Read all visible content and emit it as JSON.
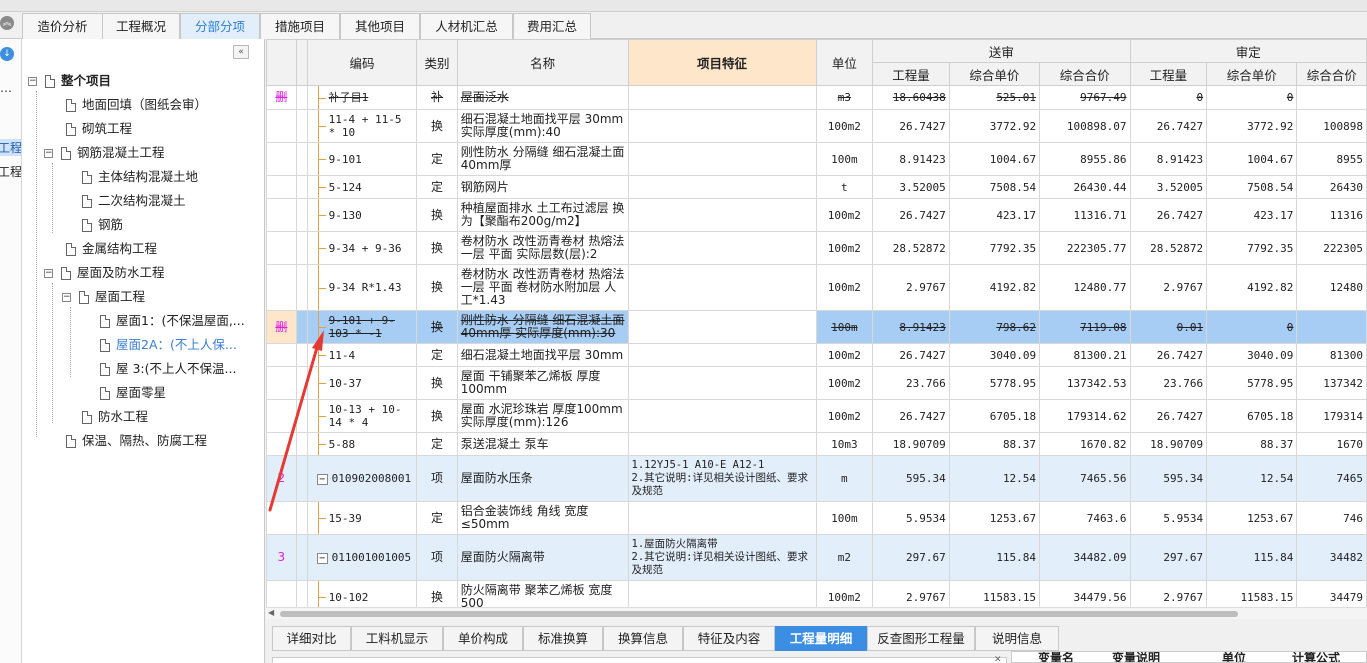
{
  "tabs": [
    "造价分析",
    "工程概况",
    "分部分项",
    "措施项目",
    "其他项目",
    "人材机汇总",
    "费用汇总"
  ],
  "active_tab_index": 2,
  "rail": {
    "dots": "…",
    "item1": "工程",
    "item2": "工程"
  },
  "tree": {
    "collapse_icon": "«",
    "items": [
      {
        "label": "整个项目",
        "bold": true
      },
      {
        "label": "地面回填（图纸会审）"
      },
      {
        "label": "砌筑工程"
      },
      {
        "label": "钢筋混凝土工程"
      },
      {
        "label": "主体结构混凝土地"
      },
      {
        "label": "二次结构混凝土"
      },
      {
        "label": "钢筋"
      },
      {
        "label": "金属结构工程"
      },
      {
        "label": "屋面及防水工程"
      },
      {
        "label": "屋面工程"
      },
      {
        "label": "屋面1：(不保温屋面,..."
      },
      {
        "label": "屋面2A：(不上人保..."
      },
      {
        "label": "屋 3:(不上人不保温..."
      },
      {
        "label": "屋面零星"
      },
      {
        "label": "防水工程"
      },
      {
        "label": "保温、隔热、防腐工程"
      }
    ]
  },
  "grid": {
    "headers": {
      "code": "编码",
      "type": "类别",
      "name": "名称",
      "feature": "项目特征",
      "unit": "单位",
      "group_submit": "送审",
      "group_review": "审定",
      "qty": "工程量",
      "unit_price": "综合单价",
      "total": "综合合价"
    },
    "rows": [
      {
        "mark": "删",
        "code": "补子目1",
        "type": "补",
        "name": "屋面泛水",
        "feature": "",
        "unit": "m3",
        "s_qty": "18.60438",
        "s_up": "525.01",
        "s_tot": "9767.49",
        "r_qty": "0",
        "r_up": "0",
        "r_tot": "",
        "kind": "del"
      },
      {
        "mark": "",
        "code": "11-4 + 11-5 * 10",
        "type": "换",
        "name": "细石混凝土地面找平层 30mm 实际厚度(mm):40",
        "feature": "",
        "unit": "100m2",
        "s_qty": "26.7427",
        "s_up": "3772.92",
        "s_tot": "100898.07",
        "r_qty": "26.7427",
        "r_up": "3772.92",
        "r_tot": "100898",
        "kind": "sub"
      },
      {
        "mark": "",
        "code": "9-101",
        "type": "定",
        "name": "刚性防水 分隔缝 细石混凝土面 40mm厚",
        "feature": "",
        "unit": "100m",
        "s_qty": "8.91423",
        "s_up": "1004.67",
        "s_tot": "8955.86",
        "r_qty": "8.91423",
        "r_up": "1004.67",
        "r_tot": "8955",
        "kind": "sub"
      },
      {
        "mark": "",
        "code": "5-124",
        "type": "定",
        "name": "钢筋网片",
        "feature": "",
        "unit": "t",
        "s_qty": "3.52005",
        "s_up": "7508.54",
        "s_tot": "26430.44",
        "r_qty": "3.52005",
        "r_up": "7508.54",
        "r_tot": "26430",
        "kind": "sub"
      },
      {
        "mark": "",
        "code": "9-130",
        "type": "换",
        "name": "种植屋面排水 土工布过滤层 换为【聚酯布200g/m2】",
        "feature": "",
        "unit": "100m2",
        "s_qty": "26.7427",
        "s_up": "423.17",
        "s_tot": "11316.71",
        "r_qty": "26.7427",
        "r_up": "423.17",
        "r_tot": "11316",
        "kind": "sub"
      },
      {
        "mark": "",
        "code": "9-34 + 9-36",
        "type": "换",
        "name": "卷材防水 改性沥青卷材 热熔法一层 平面  实际层数(层):2",
        "feature": "",
        "unit": "100m2",
        "s_qty": "28.52872",
        "s_up": "7792.35",
        "s_tot": "222305.77",
        "r_qty": "28.52872",
        "r_up": "7792.35",
        "r_tot": "222305",
        "kind": "sub"
      },
      {
        "mark": "",
        "code": "9-34 R*1.43",
        "type": "换",
        "name": "卷材防水 改性沥青卷材 热熔法一层 平面  卷材防水附加层 人工*1.43",
        "feature": "",
        "unit": "100m2",
        "s_qty": "2.9767",
        "s_up": "4192.82",
        "s_tot": "12480.77",
        "r_qty": "2.9767",
        "r_up": "4192.82",
        "r_tot": "12480",
        "kind": "sub"
      },
      {
        "mark": "删",
        "code": "9-101 + 9-103 * -1",
        "type": "换",
        "name": "刚性防水 分隔缝 细石混凝土面 40mm厚  实际厚度(mm):30",
        "feature": "",
        "unit": "100m",
        "s_qty": "8.91423",
        "s_up": "798.62",
        "s_tot": "7119.08",
        "r_qty": "0.01",
        "r_up": "0",
        "r_tot": "",
        "kind": "sel"
      },
      {
        "mark": "",
        "code": "11-4",
        "type": "定",
        "name": "细石混凝土地面找平层 30mm",
        "feature": "",
        "unit": "100m2",
        "s_qty": "26.7427",
        "s_up": "3040.09",
        "s_tot": "81300.21",
        "r_qty": "26.7427",
        "r_up": "3040.09",
        "r_tot": "81300",
        "kind": "sub"
      },
      {
        "mark": "",
        "code": "10-37",
        "type": "换",
        "name": "屋面 干铺聚苯乙烯板 厚度 100mm",
        "feature": "",
        "unit": "100m2",
        "s_qty": "23.766",
        "s_up": "5778.95",
        "s_tot": "137342.53",
        "r_qty": "23.766",
        "r_up": "5778.95",
        "r_tot": "137342",
        "kind": "sub"
      },
      {
        "mark": "",
        "code": "10-13 + 10-14 * 4",
        "type": "换",
        "name": "屋面 水泥珍珠岩 厚度100mm 实际厚度(mm):126",
        "feature": "",
        "unit": "100m2",
        "s_qty": "26.7427",
        "s_up": "6705.18",
        "s_tot": "179314.62",
        "r_qty": "26.7427",
        "r_up": "6705.18",
        "r_tot": "179314",
        "kind": "sub"
      },
      {
        "mark": "",
        "code": "5-88",
        "type": "定",
        "name": "泵送混凝土 泵车",
        "feature": "",
        "unit": "10m3",
        "s_qty": "18.90709",
        "s_up": "88.37",
        "s_tot": "1670.82",
        "r_qty": "18.90709",
        "r_up": "88.37",
        "r_tot": "1670",
        "kind": "sub"
      },
      {
        "mark": "2",
        "code": "010902008001",
        "type": "项",
        "name": "屋面防水压条",
        "feature": "1.12YJ5-1 A10-E A12-1\n2.其它说明:详见相关设计图纸、要求及规范",
        "unit": "m",
        "s_qty": "595.34",
        "s_up": "12.54",
        "s_tot": "7465.56",
        "r_qty": "595.34",
        "r_up": "12.54",
        "r_tot": "7465",
        "kind": "xiang"
      },
      {
        "mark": "",
        "code": "15-39",
        "type": "定",
        "name": "铝合金装饰线 角线 宽度≤50mm",
        "feature": "",
        "unit": "100m",
        "s_qty": "5.9534",
        "s_up": "1253.67",
        "s_tot": "7463.6",
        "r_qty": "5.9534",
        "r_up": "1253.67",
        "r_tot": "746",
        "kind": "sub"
      },
      {
        "mark": "3",
        "code": "011001001005",
        "type": "项",
        "name": "屋面防火隔离带",
        "feature": "1.屋面防火隔离带\n2.其它说明:详见相关设计图纸、要求及规范",
        "unit": "m2",
        "s_qty": "297.67",
        "s_up": "115.84",
        "s_tot": "34482.09",
        "r_qty": "297.67",
        "r_up": "115.84",
        "r_tot": "34482",
        "kind": "xiang"
      },
      {
        "mark": "",
        "code": "10-102",
        "type": "换",
        "name": "防火隔离带 聚苯乙烯板 宽度 500",
        "feature": "",
        "unit": "100m2",
        "s_qty": "2.9767",
        "s_up": "11583.15",
        "s_tot": "34479.56",
        "r_qty": "2.9767",
        "r_up": "11583.15",
        "r_tot": "34479",
        "kind": "sub"
      }
    ]
  },
  "bottom_tabs": [
    "详细对比",
    "工料机显示",
    "单价构成",
    "标准换算",
    "换算信息",
    "特征及内容",
    "工程量明细",
    "反查图形工程量",
    "说明信息"
  ],
  "bottom_active_index": 6,
  "bottom_right_headers": [
    "变量名",
    "变量说明",
    "单位",
    "计算公式"
  ],
  "colors": {
    "accent": "#3b8ee3",
    "delete_mark": "#e020e0",
    "feature_header": "#fde6c9",
    "selected_row": "#a8cdf5",
    "arrow": "#e53935"
  }
}
